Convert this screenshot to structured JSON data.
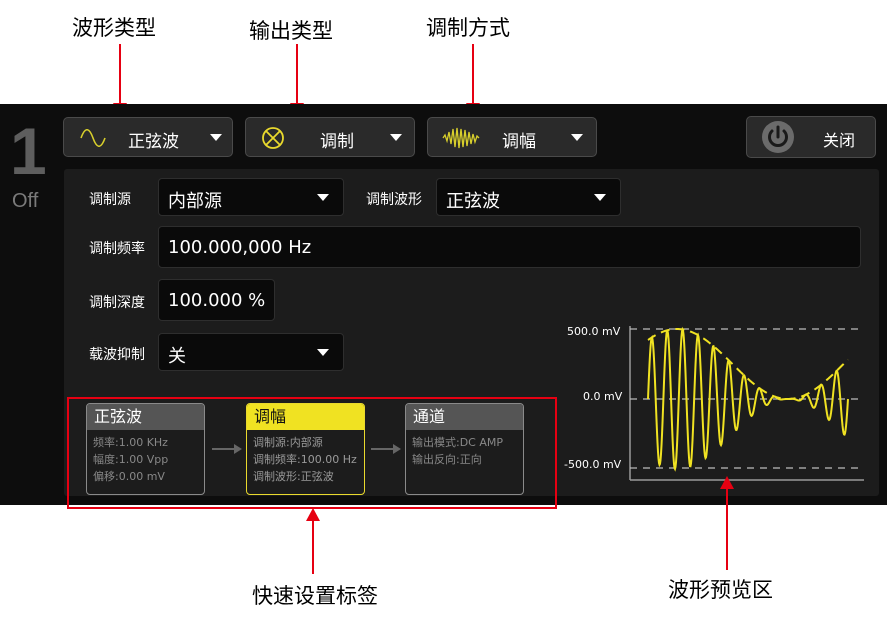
{
  "callouts": {
    "waveform_type": "波形类型",
    "output_type": "输出类型",
    "modulation_mode": "调制方式",
    "quick_tabs": "快速设置标签",
    "preview": "波形预览区"
  },
  "channel": {
    "number": "1",
    "state": "Off"
  },
  "toolbar": {
    "waveform": "正弦波",
    "output": "调制",
    "modulation": "调幅",
    "close": "关闭"
  },
  "settings": {
    "mod_source_label": "调制源",
    "mod_source_value": "内部源",
    "mod_shape_label": "调制波形",
    "mod_shape_value": "正弦波",
    "mod_freq_label": "调制频率",
    "mod_freq_value": "100.000,000 Hz",
    "mod_depth_label": "调制深度",
    "mod_depth_value": "100.000 %",
    "carrier_suppress_label": "载波抑制",
    "carrier_suppress_value": "关"
  },
  "cards": [
    {
      "title": "正弦波",
      "lines": [
        "频率:1.00 KHz",
        "幅度:1.00 Vpp",
        "偏移:0.00 mV"
      ]
    },
    {
      "title": "调幅",
      "lines": [
        "调制源:内部源",
        "调制频率:100.00 Hz",
        "调制波形:正弦波"
      ]
    },
    {
      "title": "通道",
      "lines": [
        "输出模式:DC AMP",
        "输出反向:正向"
      ]
    }
  ],
  "preview": {
    "y_labels": [
      "500.0 mV",
      "0.0 mV",
      "-500.0 mV"
    ],
    "wave_color": "#f0e222"
  }
}
